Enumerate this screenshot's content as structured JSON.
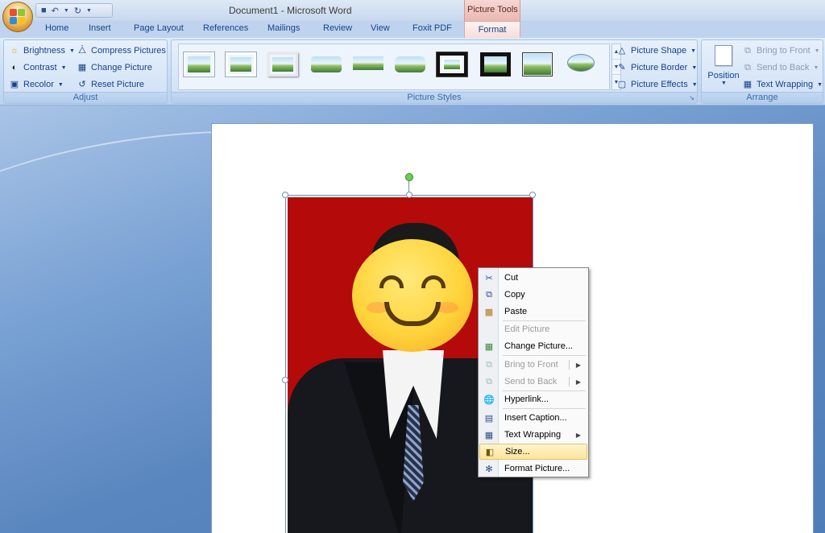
{
  "window": {
    "title": "Document1 - Microsoft Word",
    "contextual_group": "Picture Tools"
  },
  "tabs": [
    "Home",
    "Insert",
    "Page Layout",
    "References",
    "Mailings",
    "Review",
    "View",
    "Foxit PDF"
  ],
  "active_tab": "Format",
  "ribbon": {
    "adjust": {
      "label": "Adjust",
      "brightness": "Brightness",
      "contrast": "Contrast",
      "recolor": "Recolor",
      "compress": "Compress Pictures",
      "change": "Change Picture",
      "reset": "Reset Picture"
    },
    "picture_styles": {
      "label": "Picture Styles",
      "shape": "Picture Shape",
      "border": "Picture Border",
      "effects": "Picture Effects"
    },
    "arrange": {
      "label": "Arrange",
      "position": "Position",
      "bring_front": "Bring to Front",
      "send_back": "Send to Back",
      "text_wrapping": "Text Wrapping"
    }
  },
  "context_menu": {
    "cut": "Cut",
    "copy": "Copy",
    "paste": "Paste",
    "edit_picture": "Edit Picture",
    "change_picture": "Change Picture...",
    "bring_front": "Bring to Front",
    "send_back": "Send to Back",
    "hyperlink": "Hyperlink...",
    "insert_caption": "Insert Caption...",
    "text_wrapping": "Text Wrapping",
    "size": "Size...",
    "format_picture": "Format Picture..."
  },
  "colors": {
    "photo_background": "#b40a0a",
    "menu_highlight": "#fde49a",
    "ribbon_text": "#15428b"
  }
}
